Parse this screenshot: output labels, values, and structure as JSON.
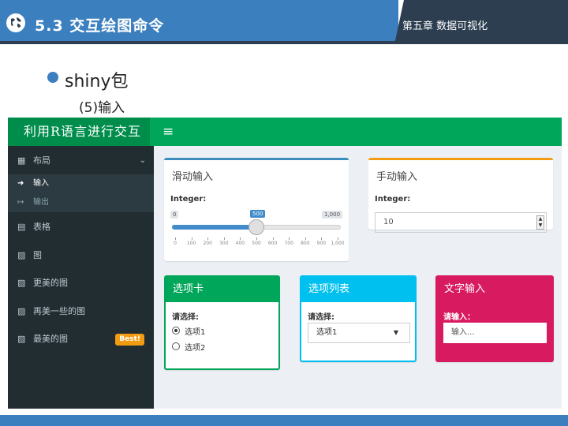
{
  "slide": {
    "title": "5.3 交互绘图命令",
    "chapter": "第五章 数据可视化",
    "bullet": "shiny包",
    "subheading": "(5)输入"
  },
  "colors": {
    "header_blue": "#3b7fbf",
    "header_dark": "#2c3e50",
    "app_green": "#00a65a",
    "info_cyan": "#00c0ef",
    "maroon_pink": "#d81b60",
    "warning_orange": "#f39c12",
    "primary_blue": "#3c8dbc"
  },
  "app": {
    "logo": "利用R语言进行交互",
    "hamburger": "≡",
    "sidebar": {
      "group": {
        "label": "布局",
        "icon": "grid-icon",
        "glyph": "▦",
        "chevron": "⌄"
      },
      "submenu": [
        {
          "label": "输入",
          "icon": "sign-in-icon",
          "glyph": "➜"
        },
        {
          "label": "输出",
          "icon": "sign-out-icon",
          "glyph": "↦"
        }
      ],
      "items": [
        {
          "label": "表格",
          "icon": "table-icon",
          "glyph": "▤"
        },
        {
          "label": "图",
          "icon": "image-icon",
          "glyph": "▨"
        },
        {
          "label": "更美的图",
          "icon": "image-icon",
          "glyph": "▨"
        },
        {
          "label": "再美一些的图",
          "icon": "image-icon",
          "glyph": "▨"
        },
        {
          "label": "最美的图",
          "icon": "image-icon",
          "glyph": "▨",
          "badge": "Best!"
        }
      ]
    },
    "slider_box": {
      "title": "滑动输入",
      "label": "Integer:",
      "min": "0",
      "max": "1,000",
      "value": "500",
      "fraction": 0.5,
      "ticks": [
        "0",
        "100",
        "200",
        "300",
        "400",
        "500",
        "600",
        "700",
        "800",
        "900",
        "1,000"
      ]
    },
    "manual_box": {
      "title": "手动输入",
      "label": "Integer:",
      "value": "10",
      "spin_up": "▲",
      "spin_down": "▼"
    },
    "tab_box": {
      "title": "选项卡",
      "label": "请选择:",
      "options": [
        {
          "label": "选项1",
          "selected": true
        },
        {
          "label": "选项2",
          "selected": false
        }
      ]
    },
    "list_box": {
      "title": "选项列表",
      "label": "请选择:",
      "selected": "选项1",
      "caret": "▼"
    },
    "text_box": {
      "title": "文字输入",
      "label": "请输入：",
      "placeholder": "输入..."
    }
  }
}
